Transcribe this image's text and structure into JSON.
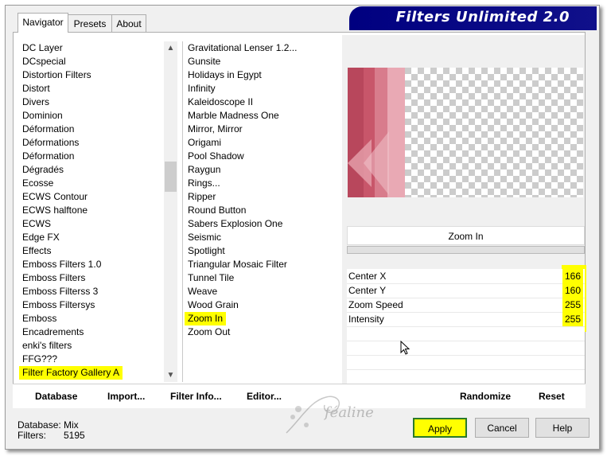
{
  "window": {
    "title": "Filters Unlimited 2.0"
  },
  "tabs": [
    {
      "label": "Navigator"
    },
    {
      "label": "Presets"
    },
    {
      "label": "About"
    }
  ],
  "categories": [
    "DC Layer",
    "DCspecial",
    "Distortion Filters",
    "Distort",
    "Divers",
    "Dominion",
    "Déformation",
    "Déformations",
    "Déformation",
    "Dégradés",
    "Ecosse",
    "ECWS Contour",
    "ECWS halftone",
    "ECWS",
    "Edge FX",
    "Effects",
    "Emboss Filters 1.0",
    "Emboss Filters",
    "Emboss Filterss 3",
    "Emboss Filtersys",
    "Emboss",
    "Encadrements",
    "enki's filters",
    "FFG???",
    "Filter Factory Gallery A"
  ],
  "filters": [
    "Gravitational Lenser 1.2...",
    "Gunsite",
    "Holidays in Egypt",
    "Infinity",
    "Kaleidoscope II",
    "Marble Madness One",
    "Mirror, Mirror",
    "Origami",
    "Pool Shadow",
    "Raygun",
    "Rings...",
    "Ripper",
    "Round Button",
    "Sabers Explosion One",
    "Seismic",
    "Spotlight",
    "Triangular Mosaic Filter",
    "Tunnel Tile",
    "Weave",
    "Wood Grain",
    "Zoom In",
    "Zoom Out"
  ],
  "selected_category": "Filter Factory Gallery A",
  "selected_filter": "Zoom In",
  "filter_name_label": "Zoom In",
  "params": [
    {
      "label": "Center X",
      "value": "166"
    },
    {
      "label": "Center Y",
      "value": "160"
    },
    {
      "label": "Zoom Speed",
      "value": "255"
    },
    {
      "label": "Intensity",
      "value": "255"
    }
  ],
  "bottom_links": {
    "database": "Database",
    "import": "Import...",
    "filter_info": "Filter Info...",
    "editor": "Editor...",
    "randomize": "Randomize",
    "reset": "Reset"
  },
  "status": {
    "database_label": "Database:",
    "database_value": "Mix",
    "filters_label": "Filters:",
    "filters_value": "5195"
  },
  "buttons": {
    "apply": "Apply",
    "cancel": "Cancel",
    "help": "Help"
  },
  "watermark_text": "féaline",
  "colors": {
    "banner": "#000080",
    "highlight": "#ffff00",
    "preview_pink": "#c8566a"
  },
  "icons": {
    "scroll_up": "chevron-up-icon",
    "scroll_down": "chevron-down-icon",
    "cursor": "mouse-cursor-icon"
  }
}
